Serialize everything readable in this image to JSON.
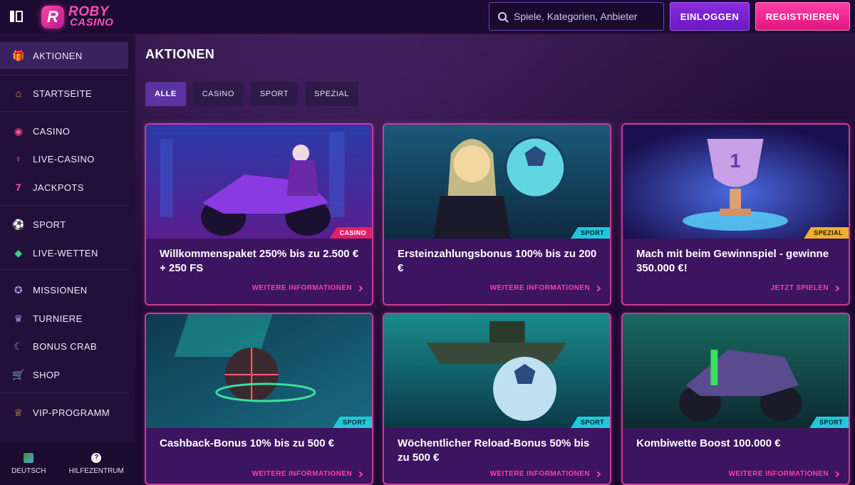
{
  "header": {
    "logo_top": "ROBY",
    "logo_bottom": "CASINO",
    "search_placeholder": "Spiele, Kategorien, Anbieter",
    "login_label": "EINLOGGEN",
    "register_label": "REGISTRIEREN"
  },
  "sidebar": {
    "items": [
      {
        "label": "AKTIONEN",
        "icon": "gift-icon"
      },
      {
        "label": "STARTSEITE",
        "icon": "home-icon"
      },
      {
        "label": "CASINO",
        "icon": "chip-icon"
      },
      {
        "label": "LIVE-CASINO",
        "icon": "dealer-icon"
      },
      {
        "label": "JACKPOTS",
        "icon": "seven-icon"
      },
      {
        "label": "SPORT",
        "icon": "football-icon"
      },
      {
        "label": "LIVE-WETTEN",
        "icon": "ticket-icon"
      },
      {
        "label": "MISSIONEN",
        "icon": "medal-icon"
      },
      {
        "label": "TURNIERE",
        "icon": "trophy-icon"
      },
      {
        "label": "BONUS CRAB",
        "icon": "crab-icon"
      },
      {
        "label": "SHOP",
        "icon": "cart-icon"
      },
      {
        "label": "VIP-PROGRAMM",
        "icon": "crown-icon"
      }
    ],
    "footer": {
      "language": "DEUTSCH",
      "help": "HILFEZENTRUM"
    }
  },
  "main": {
    "title": "AKTIONEN",
    "tabs": [
      "ALLE",
      "CASINO",
      "SPORT",
      "SPEZIAL"
    ],
    "active_tab": "ALLE",
    "cards": [
      {
        "tag": "CASINO",
        "title": "Willkommenspaket 250% bis zu 2.500 € + 250 FS",
        "link": "WEITERE INFORMATIONEN"
      },
      {
        "tag": "SPORT",
        "title": "Ersteinzahlungsbonus 100% bis zu 200 €",
        "link": "WEITERE INFORMATIONEN"
      },
      {
        "tag": "SPEZIAL",
        "title": "Mach mit beim Gewinnspiel - gewinne 350.000 €!",
        "link": "JETZT SPIELEN"
      },
      {
        "tag": "SPORT",
        "title": "Cashback-Bonus 10% bis zu 500 €",
        "link": "WEITERE INFORMATIONEN"
      },
      {
        "tag": "SPORT",
        "title": "Wöchentlicher Reload-Bonus 50% bis zu 500 €",
        "link": "WEITERE INFORMATIONEN"
      },
      {
        "tag": "SPORT",
        "title": "Kombiwette Boost 100.000 €",
        "link": "WEITERE INFORMATIONEN"
      }
    ]
  },
  "colors": {
    "accent_pink": "#ff3fa6",
    "accent_purple": "#7a24d6",
    "tag_casino": "#e0206a",
    "tag_sport": "#22c8d8",
    "tag_spezial": "#f0b030"
  }
}
